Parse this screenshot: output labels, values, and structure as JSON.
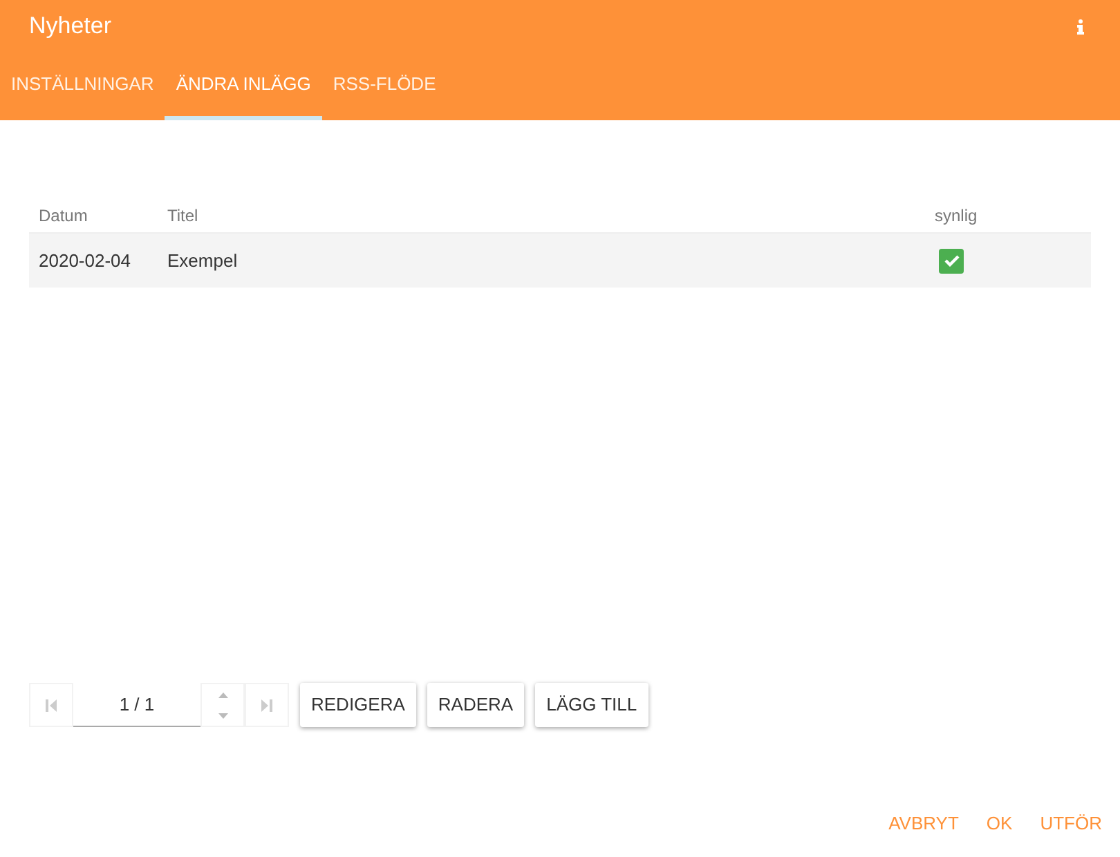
{
  "window": {
    "title": "Nyheter"
  },
  "tabs": [
    {
      "label": "INSTÄLLNINGAR",
      "selected": false
    },
    {
      "label": "ÄNDRA INLÄGG",
      "selected": true
    },
    {
      "label": "RSS-FLÖDE",
      "selected": false
    }
  ],
  "table": {
    "columns": [
      "Datum",
      "Titel",
      "synlig"
    ],
    "rows": [
      {
        "date": "2020-02-04",
        "title": "Exempel",
        "visible": true
      }
    ]
  },
  "pager": {
    "page": "1 / 1",
    "first_disabled": true,
    "last_disabled": true
  },
  "actions": [
    "REDIGERA",
    "RADERA",
    "LÄGG TILL"
  ],
  "footer_buttons": [
    "AVBRYT",
    "OK",
    "UTFÖR"
  ]
}
